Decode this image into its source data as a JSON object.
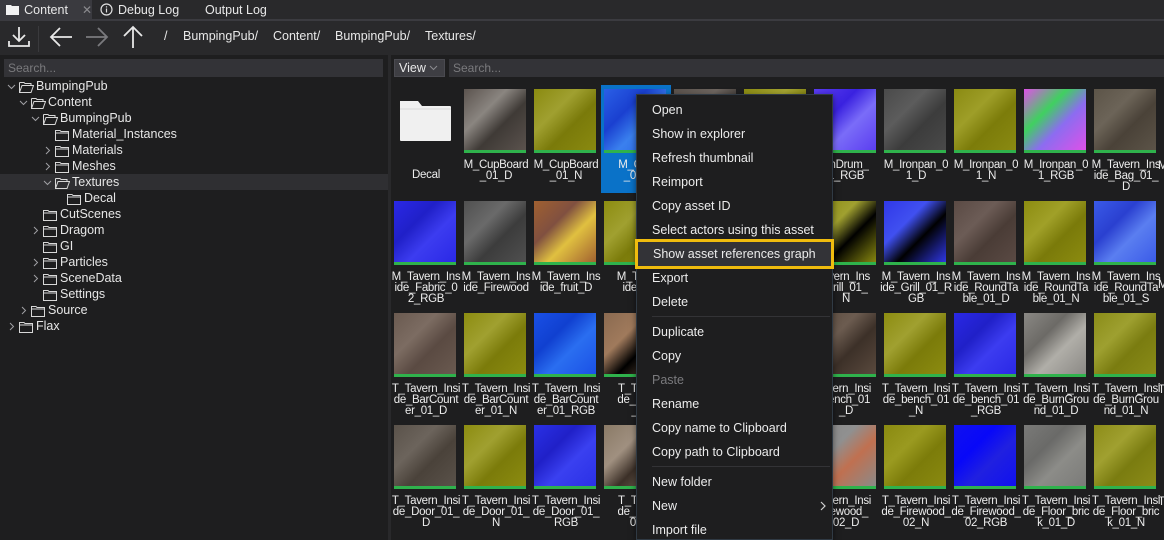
{
  "tabs": [
    {
      "label": "Content",
      "icon": "folder-icon",
      "active": true,
      "closable": true
    },
    {
      "label": "Debug Log",
      "icon": "info-icon",
      "active": false
    },
    {
      "label": "Output Log",
      "active": false
    }
  ],
  "toolbar": {
    "import_icon": "download-icon",
    "back_icon": "arrow-left-icon",
    "forward_icon": "arrow-right-icon",
    "up_icon": "arrow-up-icon",
    "breadcrumb": [
      "/",
      "BumpingPub/",
      "Content/",
      "BumpingPub/",
      "Textures/"
    ]
  },
  "left_panel": {
    "search_placeholder": "Search...",
    "tree": [
      {
        "label": "BumpingPub",
        "depth": 0,
        "expander": "expanded",
        "open": true
      },
      {
        "label": "Content",
        "depth": 1,
        "expander": "expanded",
        "open": true
      },
      {
        "label": "BumpingPub",
        "depth": 2,
        "expander": "expanded",
        "open": true
      },
      {
        "label": "Material_Instances",
        "depth": 3,
        "expander": "none"
      },
      {
        "label": "Materials",
        "depth": 3,
        "expander": "collapsed"
      },
      {
        "label": "Meshes",
        "depth": 3,
        "expander": "collapsed"
      },
      {
        "label": "Textures",
        "depth": 3,
        "expander": "expanded",
        "open": true,
        "selected": true
      },
      {
        "label": "Decal",
        "depth": 4,
        "expander": "none"
      },
      {
        "label": "CutScenes",
        "depth": 2,
        "expander": "none"
      },
      {
        "label": "Dragom",
        "depth": 2,
        "expander": "collapsed"
      },
      {
        "label": "GI",
        "depth": 2,
        "expander": "none"
      },
      {
        "label": "Particles",
        "depth": 2,
        "expander": "collapsed"
      },
      {
        "label": "SceneData",
        "depth": 2,
        "expander": "collapsed"
      },
      {
        "label": "Settings",
        "depth": 2,
        "expander": "none"
      },
      {
        "label": "Source",
        "depth": 1,
        "expander": "collapsed"
      },
      {
        "label": "Flax",
        "depth": 0,
        "expander": "collapsed"
      }
    ]
  },
  "right_panel": {
    "view_label": "View",
    "search_placeholder": "Search...",
    "items": [
      {
        "name": "Decal",
        "type": "folder"
      },
      {
        "name": "M_CupBoard\n_01_D",
        "colors": [
          "#5b534e",
          "#3f3a36",
          "#8a8580"
        ]
      },
      {
        "name": "M_CupBoard\n_01_N",
        "colors": [
          "#8a8a10",
          "#7a7a0a",
          "#a0a030"
        ]
      },
      {
        "name": "M_Cup\n_01_",
        "colors": [
          "#2a5fe6",
          "#3a80ee",
          "#1a40d0"
        ],
        "selected": true
      },
      {
        "name": "",
        "colors": [
          "#5a524c",
          "#3c3733",
          "#6e6660"
        ]
      },
      {
        "name": "",
        "colors": [
          "#8c8c12",
          "#7b7b0b",
          "#a4a432"
        ]
      },
      {
        "name": "onDrum_\n1_RGB",
        "colors": [
          "#5a3cf0",
          "#7a6cf8",
          "#3a22e0"
        ]
      },
      {
        "name": "M_Ironpan_0\n1_D",
        "colors": [
          "#4a4a4a",
          "#3c3c3c",
          "#5c5c5c"
        ]
      },
      {
        "name": "M_Ironpan_0\n1_N",
        "colors": [
          "#8a8a12",
          "#7c7c0a",
          "#9e9e28"
        ]
      },
      {
        "name": "M_Ironpan_0\n1_RGB",
        "colors": [
          "#e050e8",
          "#8c6cf0",
          "#40d060"
        ]
      },
      {
        "name": "M_Tavern_Ins\nide_Bag_01_\nD",
        "colors": [
          "#5c5448",
          "#4a4238",
          "#6c6458"
        ]
      },
      {
        "name": "M_Tavern_Ins\nide_Fabric_0\n2_RGB",
        "colors": [
          "#2a28e6",
          "#3c3cf0",
          "#2020c8"
        ]
      },
      {
        "name": "M_Tavern_Ins\nide_Firewood",
        "colors": [
          "#505050",
          "#3c3c3c",
          "#6a6a6a"
        ]
      },
      {
        "name": "M_Tavern_Ins\nide_fruit_D",
        "colors": [
          "#a06030",
          "#e0c040",
          "#805040"
        ]
      },
      {
        "name": "M_Tave\nide_fr",
        "colors": [
          "#8c8c10",
          "#7b7b0a",
          "#a0a030"
        ]
      },
      {
        "name": "",
        "colors": [
          "#5a524c",
          "#3c3733",
          "#6e6660"
        ]
      },
      {
        "name": "",
        "colors": [
          "#8c8c12",
          "#7b7b0b",
          "#a4a432"
        ]
      },
      {
        "name": "avern_Ins\nGrill_01_\nN",
        "colors": [
          "#8a8a10",
          "#000000",
          "#a0a030"
        ]
      },
      {
        "name": "M_Tavern_Ins\nide_Grill_01_R\nGB",
        "colors": [
          "#3038e8",
          "#000000",
          "#4050f0"
        ]
      },
      {
        "name": "M_Tavern_Ins\nide_RoundTa\nble_01_D",
        "colors": [
          "#5a4a44",
          "#4a3c36",
          "#6c5c56"
        ]
      },
      {
        "name": "M_Tavern_Ins\nide_RoundTa\nble_01_N",
        "colors": [
          "#8c8c10",
          "#7a7a0a",
          "#a0a028"
        ]
      },
      {
        "name": "M_Tavern_Ins\nide_RoundTa\nble_01_S",
        "colors": [
          "#3a5ae8",
          "#5a7ef0",
          "#2a40d0"
        ]
      },
      {
        "name": "T_Tavern_Insi\nde_BarCount\ner_01_D",
        "colors": [
          "#6a5a50",
          "#5a4a42",
          "#7c6c62"
        ]
      },
      {
        "name": "T_Tavern_Insi\nde_BarCount\ner_01_N",
        "colors": [
          "#8c8c10",
          "#7b7b0a",
          "#a0a030"
        ]
      },
      {
        "name": "T_Tavern_Insi\nde_BarCount\ner_01_RGB",
        "colors": [
          "#1a50e6",
          "#2a6ef0",
          "#1040d0"
        ]
      },
      {
        "name": "T_Tave\nde_Bas\n_I",
        "colors": [
          "#8a6a50",
          "#000000",
          "#a07a5c"
        ]
      },
      {
        "name": "",
        "colors": [
          "#5a524c",
          "#3c3733",
          "#6e6660"
        ]
      },
      {
        "name": "",
        "colors": [
          "#8c8c12",
          "#7b7b0b",
          "#a4a432"
        ]
      },
      {
        "name": "avern_Insi\nbench_01\n_D",
        "colors": [
          "#5a4a3e",
          "#3c3028",
          "#6c5c50"
        ]
      },
      {
        "name": "T_Tavern_Insi\nde_bench_01\n_N",
        "colors": [
          "#8c8c10",
          "#7b7b0a",
          "#a0a030"
        ]
      },
      {
        "name": "T_Tavern_Insi\nde_bench_01\n_RGB",
        "colors": [
          "#2a28e6",
          "#3c3cf0",
          "#2020c8"
        ]
      },
      {
        "name": "T_Tavern_Insi\nde_BurnGrou\nnd_01_D",
        "colors": [
          "#8a8884",
          "#b0aea8",
          "#6c6a66"
        ]
      },
      {
        "name": "T_Tavern_Insi\nde_BurnGrou\nnd_01_N",
        "colors": [
          "#8a8c18",
          "#7a7c10",
          "#9ea030"
        ]
      },
      {
        "name": "T_Tavern_Insi\nde_Door_01_\nD",
        "colors": [
          "#5a524a",
          "#4a423a",
          "#6c645c"
        ]
      },
      {
        "name": "T_Tavern_Insi\nde_Door_01_\nN",
        "colors": [
          "#8c8c10",
          "#7b7b0a",
          "#a0a030"
        ]
      },
      {
        "name": "T_Tavern_Insi\nde_Door_01_\nRGB",
        "colors": [
          "#2a30e6",
          "#3a40f0",
          "#2020c8"
        ]
      },
      {
        "name": "T_Tave\nde_Fire\n01",
        "colors": [
          "#8a7a66",
          "#3c3028",
          "#a09080"
        ]
      },
      {
        "name": "",
        "colors": [
          "#5a524c",
          "#3c3733",
          "#6e6660"
        ]
      },
      {
        "name": "",
        "colors": [
          "#8c8c12",
          "#7b7b0b",
          "#a4a432"
        ]
      },
      {
        "name": "avern_Insi\nirewood_\n02_D",
        "colors": [
          "#8a8a8a",
          "#c07050",
          "#909090"
        ]
      },
      {
        "name": "T_Tavern_Insi\nde_Firewood_\n02_N",
        "colors": [
          "#8a8a10",
          "#7c7c0a",
          "#9a9a20"
        ]
      },
      {
        "name": "T_Tavern_Insi\nde_Firewood_\n02_RGB",
        "colors": [
          "#1010f0",
          "#2020e0",
          "#0808f8"
        ]
      },
      {
        "name": "T_Tavern_Insi\nde_Floor_bric\nk_01_D",
        "colors": [
          "#7a7a78",
          "#8c8c88",
          "#6a6a68"
        ]
      },
      {
        "name": "T_Tavern_Insi\nde_Floor_bric\nk_01_N",
        "colors": [
          "#8c8c18",
          "#7a7c10",
          "#a0a030"
        ]
      }
    ],
    "overflow_labels": [
      "M",
      "M",
      "T",
      "T"
    ]
  },
  "context_menu": {
    "groups": [
      [
        {
          "label": "Open"
        },
        {
          "label": "Show in explorer"
        },
        {
          "label": "Refresh thumbnail"
        },
        {
          "label": "Reimport"
        },
        {
          "label": "Copy asset ID"
        },
        {
          "label": "Select actors using this asset"
        },
        {
          "label": "Show asset references graph",
          "highlighted": true
        },
        {
          "label": "Export"
        },
        {
          "label": "Delete"
        }
      ],
      [
        {
          "label": "Duplicate"
        },
        {
          "label": "Copy"
        },
        {
          "label": "Paste",
          "disabled": true
        },
        {
          "label": "Rename"
        },
        {
          "label": "Copy name to Clipboard"
        },
        {
          "label": "Copy path to Clipboard"
        }
      ],
      [
        {
          "label": "New folder"
        },
        {
          "label": "New",
          "submenu": true
        },
        {
          "label": "Import file"
        }
      ]
    ],
    "highlight_color": "#f0bc0e"
  },
  "colors": {
    "selection": "#0a72c8",
    "asset_bar": "#2fb24c",
    "panel_bg": "#1e1e1f",
    "toolbar_bg": "#29292b"
  }
}
